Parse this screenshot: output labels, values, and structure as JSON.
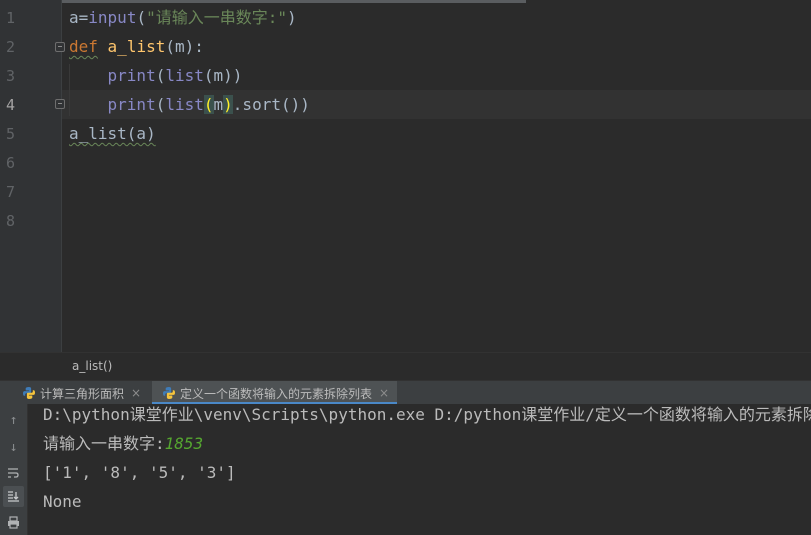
{
  "editor": {
    "line_numbers": [
      "1",
      "2",
      "3",
      "4",
      "5",
      "6",
      "7",
      "8"
    ],
    "active_line": "4",
    "line1": {
      "a": "a",
      "eq": "=",
      "input": "input",
      "open": "(",
      "str": "\"请输入一串数字:\"",
      "close": ")"
    },
    "line2": {
      "def": "def",
      "name": "a_list",
      "params": "(m):"
    },
    "line3": {
      "print": "print",
      "open": "(",
      "list": "list",
      "args": "(m))"
    },
    "line4": {
      "print": "print",
      "open": "(",
      "list": "list",
      "paren_open": "(",
      "m": "m",
      "paren_close": ")",
      "rest": ".sort())"
    },
    "line5": {
      "call": "a_list(a)"
    }
  },
  "breadcrumb": {
    "text": "a_list()"
  },
  "run_tabs": [
    {
      "label": "计算三角形面积",
      "close": "×",
      "icon": "python-icon"
    },
    {
      "label": "定义一个函数将输入的元素拆除列表",
      "close": "×",
      "icon": "python-icon"
    }
  ],
  "console": {
    "side_icons": [
      "arrow-up-icon",
      "arrow-down-icon",
      "soft-wrap-icon",
      "scroll-to-end-icon",
      "print-icon"
    ],
    "lines": {
      "cmd": "D:\\python课堂作业\\venv\\Scripts\\python.exe D:/python课堂作业/定义一个函数将输入的元素拆除列表",
      "prompt": "请输入一串数字:",
      "user_input": "1853",
      "result": "['1', '8', '5', '3']",
      "none": "None"
    }
  },
  "colors": {
    "background": "#2b2b2b",
    "keyword": "#cc7832",
    "builtin": "#8888c6",
    "function": "#ffc66d",
    "string": "#6a8759",
    "user_input": "#55a630",
    "tab_accent": "#4a88c7"
  }
}
